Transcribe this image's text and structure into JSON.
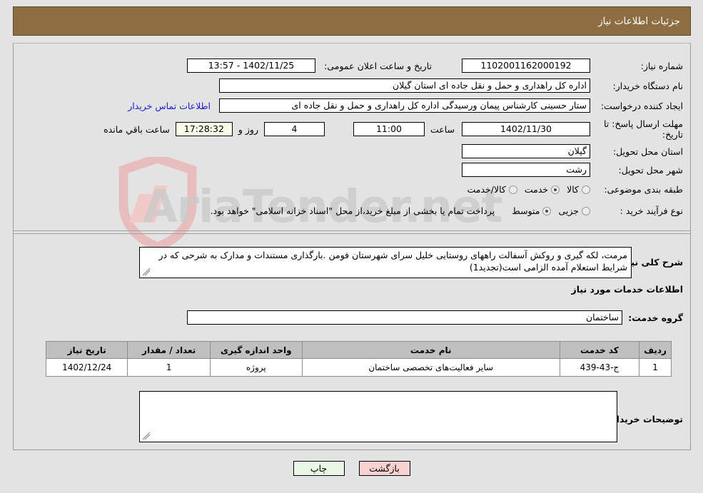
{
  "header": {
    "title": "جزئیات اطلاعات نیاز"
  },
  "watermark": {
    "text": "AriaTender.net"
  },
  "form": {
    "need_number_label": "شماره نیاز:",
    "need_number_value": "1102001162000192",
    "announce_label": "تاریخ و ساعت اعلان عمومی:",
    "announce_value": "1402/11/25 - 13:57",
    "buyer_org_label": "نام دستگاه خریدار:",
    "buyer_org_value": "اداره کل راهداری و حمل و نقل جاده ای استان گیلان",
    "creator_label": "ایجاد کننده درخواست:",
    "creator_value": "ستار حسینی کارشناس پیمان ورسیدگی اداره کل راهداری و حمل و نقل جاده ای",
    "contact_link": "اطلاعات تماس خریدار",
    "deadline_label": "مهلت ارسال پاسخ: تا تاریخ:",
    "deadline_date": "1402/11/30",
    "hour_label": "ساعت",
    "hour_value": "11:00",
    "days_value": "4",
    "days_label": "روز و",
    "countdown_value": "17:28:32",
    "remaining_label": "ساعت باقي مانده",
    "province_label": "استان محل تحویل:",
    "province_value": "گیلان",
    "city_label": "شهر محل تحویل:",
    "city_value": "رشت",
    "classification_label": "طبقه بندی موضوعی:",
    "classification_options": [
      {
        "label": "کالا",
        "selected": false
      },
      {
        "label": "خدمت",
        "selected": true
      },
      {
        "label": "کالا/خدمت",
        "selected": false
      }
    ],
    "process_label": "نوع فرآیند خرید :",
    "process_options": [
      {
        "label": "جزیی",
        "selected": false
      },
      {
        "label": "متوسط",
        "selected": true
      }
    ],
    "treasury_note": "پرداخت تمام یا بخشی از مبلغ خرید،از محل \"اسناد خزانه اسلامی\" خواهد بود.",
    "summary_label": "شرح کلی نیاز:",
    "summary_value": "مرمت، لکه گیری و روکش آسفالت راههای روستایی خلیل سرای شهرستان فومن .بارگذاری مستندات و مدارک به شرحی که در شرایط استعلام آمده الزامی است(تجدید1)",
    "services_section_title": "اطلاعات خدمات مورد نیاز",
    "service_group_label": "گروه خدمت:",
    "service_group_value": "ساختمان",
    "buyer_notes_label": "توضیحات خریدار:",
    "buyer_notes_value": ""
  },
  "table": {
    "columns": [
      "ردیف",
      "کد خدمت",
      "نام خدمت",
      "واحد اندازه گیری",
      "تعداد / مقدار",
      "تاریخ نیاز"
    ],
    "rows": [
      {
        "index": "1",
        "code": "ج-43-439",
        "name": "سایر فعالیت‌های تخصصی ساختمان",
        "unit": "پروژه",
        "qty": "1",
        "date": "1402/12/24"
      }
    ]
  },
  "buttons": {
    "back": "بازگشت",
    "print": "چاپ"
  },
  "colors": {
    "header_bg": "#8f6d42",
    "table_header_bg": "#c0c0c0",
    "link": "#1a1ad0",
    "back_btn_bg": "#fbd2d2",
    "print_btn_bg": "#e9f7e4",
    "countdown_bg": "#fbfbe8"
  }
}
